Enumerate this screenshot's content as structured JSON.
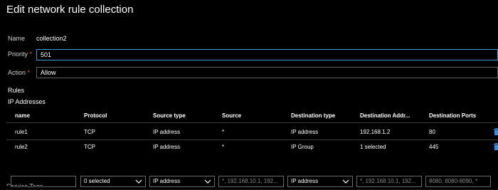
{
  "page": {
    "title": "Edit network rule collection"
  },
  "form": {
    "name_label": "Name",
    "name_value": "collection2",
    "priority_label": "Priority",
    "priority_required": "*",
    "priority_value": "501",
    "action_label": "Action",
    "action_required": "*",
    "action_value": "Allow"
  },
  "rules": {
    "section_label": "Rules",
    "subsection_label": "IP Addresses",
    "columns": [
      "name",
      "Protocol",
      "Source type",
      "Source",
      "Destination type",
      "Destination Addr...",
      "Destination Ports"
    ],
    "rows": [
      {
        "name": "rule1",
        "protocol": "TCP",
        "source_type": "IP address",
        "source": "*",
        "destination_type": "IP address",
        "destination_address": "192.168.1.2",
        "destination_ports": "80"
      },
      {
        "name": "rule2",
        "protocol": "TCP",
        "source_type": "IP address",
        "source": "*",
        "destination_type": "IP Group",
        "destination_address": "1 selected",
        "destination_ports": "445"
      }
    ],
    "new_row": {
      "name_value": "",
      "protocol_value": "0 selected",
      "source_type_value": "IP address",
      "source_placeholder": "*, 192.168.10.1, 192...",
      "destination_type_value": "IP address",
      "destination_address_placeholder": "*, 192.168.10.1, 192...",
      "destination_ports_placeholder": "8080, 8080-8090, *"
    }
  },
  "footer": {
    "partial_label": "Service Tags"
  },
  "icons": {
    "delete": "trash-icon",
    "dropdown": "chevron-down-icon",
    "scroll_left": "caret-left-icon"
  },
  "colors": {
    "background": "#000000",
    "required": "#e8636a",
    "focus_border": "#3d9bd6",
    "delete_icon": "#3a8fd8"
  }
}
